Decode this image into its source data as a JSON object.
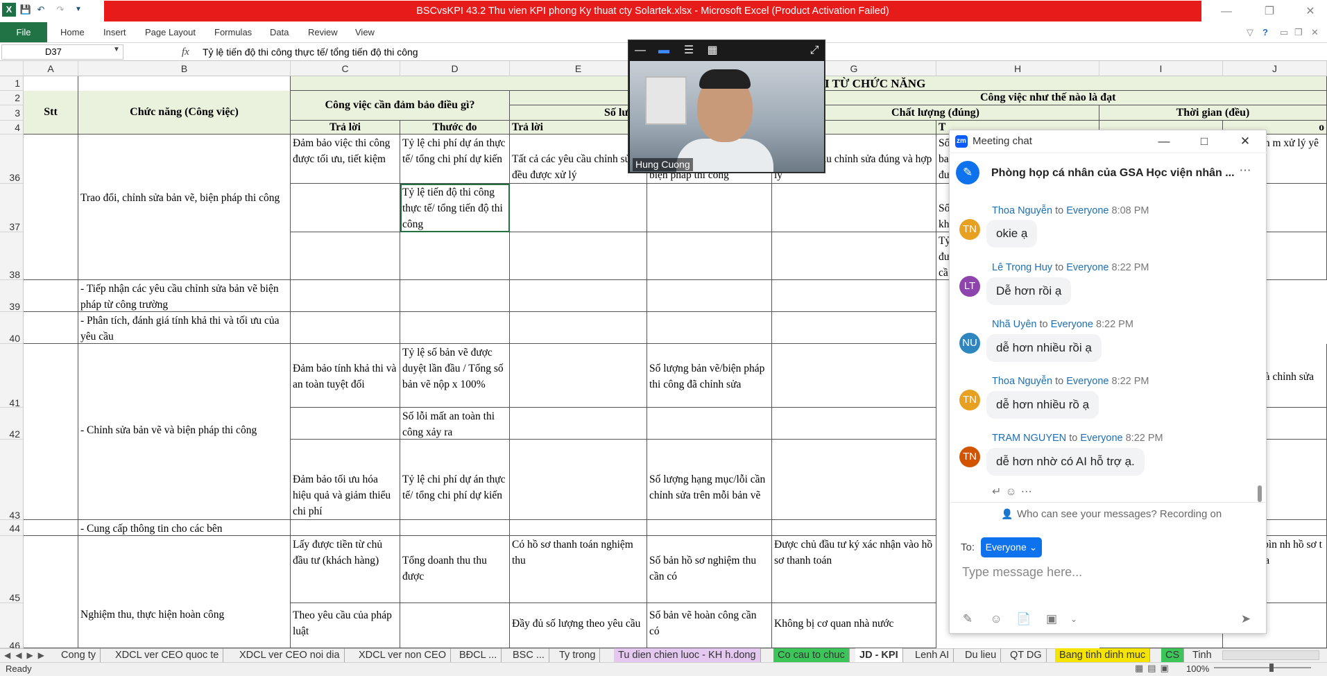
{
  "window": {
    "title": "BSCvsKPI 43.2 Thu vien KPI phong Ky thuat cty Solartek.xlsx - Microsoft Excel (Product Activation Failed)"
  },
  "ribbon": {
    "file": "File",
    "tabs": [
      "Home",
      "Insert",
      "Page Layout",
      "Formulas",
      "Data",
      "Review",
      "View"
    ]
  },
  "formula_bar": {
    "name_box": "D37",
    "fx": "fx",
    "content": "Tỷ lệ tiến độ thi công thực tế/ tổng tiến độ thi công"
  },
  "columns": [
    "A",
    "B",
    "C",
    "D",
    "E",
    "F",
    "G",
    "H",
    "I",
    "J"
  ],
  "rows": [
    "1",
    "2",
    "3",
    "4",
    "36",
    "37",
    "38",
    "39",
    "40",
    "41",
    "42",
    "43",
    "44",
    "45",
    "46"
  ],
  "header": {
    "title_partial": "I TỪ CHỨC NĂNG",
    "stt": "Stt",
    "chuc_nang": "Chức năng (Công việc)",
    "dam_bao": "Công việc cần đảm bảo điều gì?",
    "nhu_the_nao": "Công việc như thế nào là đạt",
    "so_luong": "Số lư",
    "chat_luong": "Chất lượng (đúng)",
    "thoi_gian": "Thời gian (đều)",
    "tra_loi_c": "Trả lời",
    "thuoc_do_d": "Thước đo",
    "tra_loi_e": "Trả lời",
    "h_frag": "T",
    "j_frag": "o"
  },
  "cells": {
    "c36": "Đảm bảo việc thi công được tối ưu, tiết kiệm",
    "d36": "Tỷ lệ chi phí dự án thực tế/ tổng chi phí dự kiến",
    "e36": "Tất cả các yêu cầu chỉnh sửa đều được xử lý",
    "f36": "biện pháp thi công",
    "g36": "được yêu cầu chỉnh sửa đúng và hợp lý",
    "h36": "Số ba đư",
    "j36": "ỉ phản nàn m xử lý yê a bản vẽ",
    "b36": "Trao đổi, chỉnh sửa bản vẽ, biện pháp thi công",
    "d37": "Tỷ lệ tiến độ thi công thực tế/ tổng tiến độ thi công",
    "h37": "Số kh",
    "h38": "Tỷ đư cầ",
    "b39": "- Tiếp nhận các yêu cầu chỉnh sửa bản vẽ biện pháp từ công trường",
    "b40": "- Phân tích, đánh giá tính khả thi và tối ưu của yêu cầu",
    "c41": "Đảm bảo tính khả thi và an toàn tuyệt đối",
    "d41": "Tỷ lệ số bản vẽ được duyệt lần đầu / Tổng số bản vẽ nộp x 100%",
    "f41": "Số lượng bản vẽ/biện pháp thi công đã chỉnh sửa",
    "h41": "Tỷ lầ tổ",
    "j41": "n hoàn thà chỉnh sửa",
    "b42": "- Chỉnh sửa bản vẽ và biện pháp thi công",
    "d42": "Số lỗi mất an toàn thi công xảy ra",
    "c43": "Đảm bảo tối ưu hóa hiệu quả và giảm thiểu chi phí",
    "d43": "Tỷ lệ chi phí dự án thực tế/ tổng chi phí dự kiến",
    "f43": "Số lượng hạng mục/lỗi cần chỉnh sửa trên mỗi bản vẽ",
    "h43": "Số kí liệ sa",
    "b44": "- Cung cấp thông tin cho các bên",
    "c45": "Lấy được tiền từ chủ đầu tư (khách hàng)",
    "d45": "Tổng doanh thu thu được",
    "e45": "Có hồ sơ thanh toán nghiệm thu",
    "f45": "Số bản hồ sơ nghiệm thu cần có",
    "g45": "Được chủ đầu tư ký xác nhận vào hồ sơ thanh toán",
    "h45": "Tổ",
    "j45": "ạn trung bìn nh hồ sơ t ớc hạn tha",
    "b45": "Nghiệm thu, thực hiện hoàn công",
    "c46": "Theo yêu cầu của pháp luật",
    "e46": "Đầy đủ số lượng theo yêu cầu",
    "f46": "Số bản vẽ hoàn công cần có",
    "g46": "Không bị cơ quan nhà nước",
    "h46": "Số công trung bình: 1"
  },
  "zoom_video": {
    "participant": "Hung Cuong"
  },
  "chat": {
    "window_title": "Meeting chat",
    "room_name": "Phòng họp cá nhân của GSA Học viện nhân ...",
    "messages": [
      {
        "initials": "TN",
        "color": "#e8a020",
        "sender": "Thoa Nguyễn",
        "to": "to",
        "audience": "Everyone",
        "time": "8:08 PM",
        "text": "okie ạ"
      },
      {
        "initials": "LT",
        "color": "#8e44ad",
        "sender": "Lê Trọng Huy",
        "to": "to",
        "audience": "Everyone",
        "time": "8:22 PM",
        "text": "Dễ hơn rồi ạ"
      },
      {
        "initials": "NU",
        "color": "#2e86c1",
        "sender": "Nhã Uyên",
        "to": "to",
        "audience": "Everyone",
        "time": "8:22 PM",
        "text": "dễ hơn nhiều rồi ạ"
      },
      {
        "initials": "TN",
        "color": "#e8a020",
        "sender": "Thoa Nguyễn",
        "to": "to",
        "audience": "Everyone",
        "time": "8:22 PM",
        "text": "dễ hơn nhiều rồ ạ"
      },
      {
        "initials": "TN",
        "color": "#d35400",
        "sender": "TRAM NGUYEN",
        "to": "to",
        "audience": "Everyone",
        "time": "8:22 PM",
        "text": "dễ hơn nhờ có AI hỗ trợ ạ."
      }
    ],
    "visibility_note": "Who can see your messages? Recording on",
    "to_label": "To:",
    "recipient": "Everyone",
    "input_placeholder": "Type message here..."
  },
  "sheet_tabs": [
    {
      "label": "Cong ty",
      "color": ""
    },
    {
      "label": "XDCL ver CEO quoc te",
      "color": ""
    },
    {
      "label": "XDCL ver CEO noi dia",
      "color": ""
    },
    {
      "label": "XDCL ver non CEO",
      "color": ""
    },
    {
      "label": "BĐCL ...",
      "color": ""
    },
    {
      "label": "BSC ...",
      "color": ""
    },
    {
      "label": "Ty trong",
      "color": ""
    },
    {
      "label": "Tu dien chien luoc - KH h.dong",
      "color": "#e4c8f0"
    },
    {
      "label": "Co cau to chuc",
      "color": "#3cc65a"
    },
    {
      "label": "JD - KPI",
      "color": "#ffffff"
    },
    {
      "label": "Lenh AI",
      "color": ""
    },
    {
      "label": "Du lieu",
      "color": ""
    },
    {
      "label": "QT DG",
      "color": ""
    },
    {
      "label": "Bang tinh dinh muc",
      "color": "#f5e400"
    },
    {
      "label": "CS",
      "color": "#3cc65a"
    },
    {
      "label": "Tinh",
      "color": ""
    }
  ],
  "status": {
    "ready": "Ready",
    "zoom": "100%"
  },
  "colors": {
    "excel_green": "#217346",
    "title_red": "#e81b1b",
    "zoom_blue": "#0e72ed",
    "header_fill": "#eaf1dd"
  }
}
